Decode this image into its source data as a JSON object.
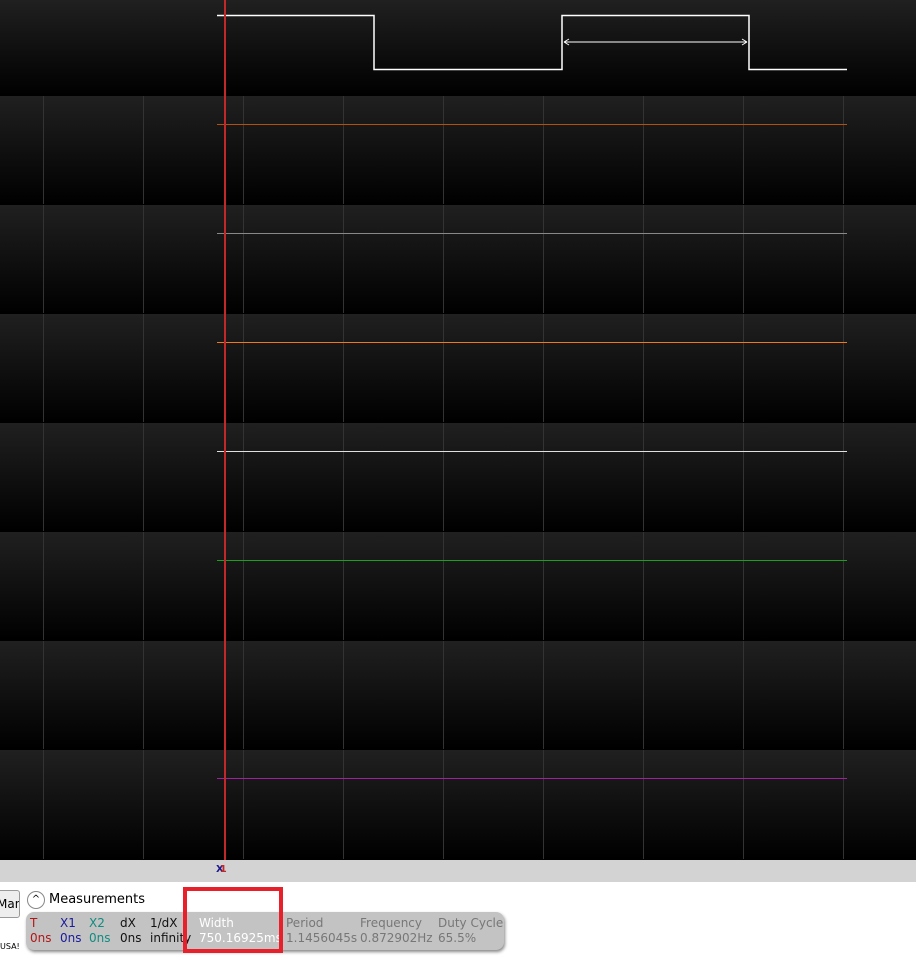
{
  "cursor_label": {
    "x1": "X",
    "t": "1"
  },
  "manual_button": "Man",
  "footer_text": "USA!",
  "measurements": {
    "title": "Measurements",
    "columns": [
      {
        "label": "T",
        "value": "0ns",
        "color": "#b01818"
      },
      {
        "label": "X1",
        "value": "0ns",
        "color": "#1a1a9c"
      },
      {
        "label": "X2",
        "value": "0ns",
        "color": "#108c80"
      },
      {
        "label": "dX",
        "value": "0ns",
        "color": "#111111"
      },
      {
        "label": "1/dX",
        "value": "infinity",
        "color": "#111111"
      },
      {
        "label": "Width",
        "value": "750.16925ms",
        "color": "#ffffff"
      },
      {
        "label": "Period",
        "value": "1.1456045s",
        "color": "#777777"
      },
      {
        "label": "Frequency",
        "value": "0.872902Hz",
        "color": "#777777"
      },
      {
        "label": "Duty Cycle",
        "value": "65.5%",
        "color": "#777777"
      }
    ]
  },
  "channel_colors": [
    "#ffffff",
    "#b4500f",
    "#888888",
    "#f07818",
    "#e0e0e0",
    "#1aa01a",
    "",
    "#a020a0"
  ]
}
